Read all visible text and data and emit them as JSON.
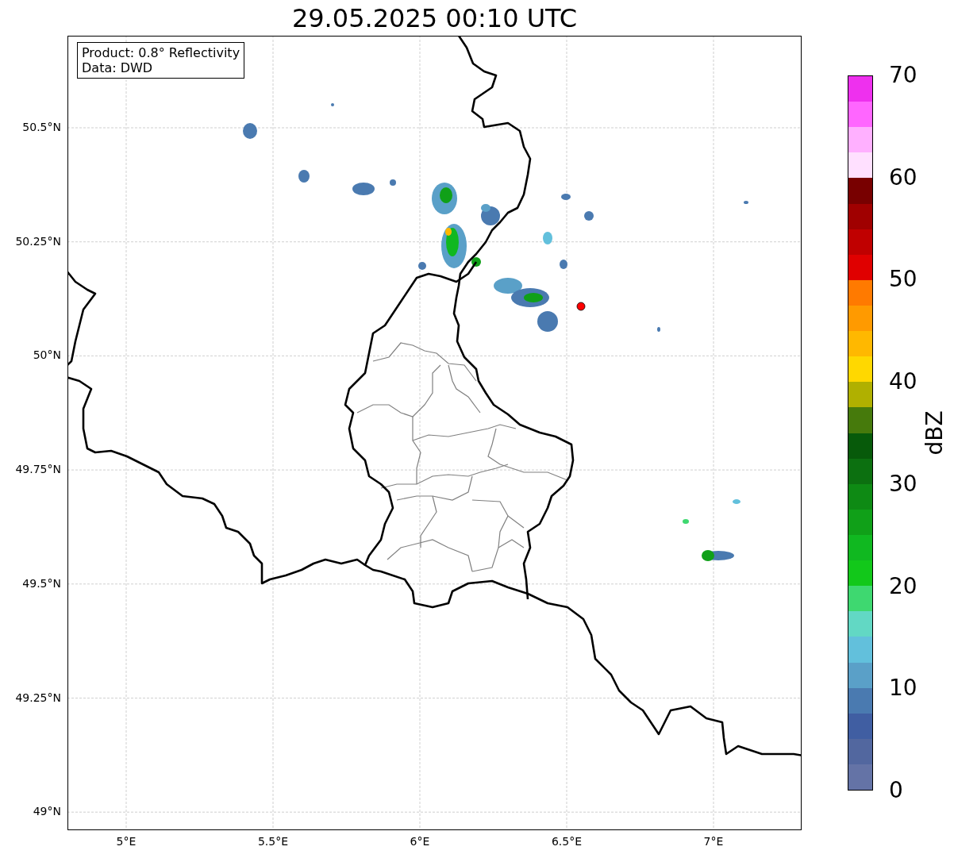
{
  "title": "29.05.2025 00:10 UTC",
  "info_box": [
    "Product: 0.8° Reflectivity",
    "Data: DWD"
  ],
  "map": {
    "x_ticks": [
      "5°E",
      "5.5°E",
      "6°E",
      "6.5°E",
      "7°E"
    ],
    "y_ticks": [
      "50.5°N",
      "50.25°N",
      "50°N",
      "49.75°N",
      "49.5°N",
      "49.25°N",
      "49°N"
    ]
  },
  "colorbar": {
    "label": "dBZ",
    "ticks": [
      "70",
      "60",
      "50",
      "40",
      "30",
      "20",
      "10",
      "0"
    ],
    "segments": [
      {
        "color": "#ee30ee"
      },
      {
        "color": "#ff66ff"
      },
      {
        "color": "#ffb0ff"
      },
      {
        "color": "#ffe0ff"
      },
      {
        "color": "#780000"
      },
      {
        "color": "#a00000"
      },
      {
        "color": "#c00000"
      },
      {
        "color": "#e00000"
      },
      {
        "color": "#ff7a00"
      },
      {
        "color": "#ff9a00"
      },
      {
        "color": "#ffb800"
      },
      {
        "color": "#ffd800"
      },
      {
        "color": "#b0b000"
      },
      {
        "color": "#467a0c"
      },
      {
        "color": "#075a0a"
      },
      {
        "color": "#0c7010"
      },
      {
        "color": "#0e8a14"
      },
      {
        "color": "#10a018"
      },
      {
        "color": "#10b820"
      },
      {
        "color": "#12c81a"
      },
      {
        "color": "#3ed870"
      },
      {
        "color": "#62d8c4"
      },
      {
        "color": "#62c0dc"
      },
      {
        "color": "#5aa0c8"
      },
      {
        "color": "#4a7ab0"
      },
      {
        "color": "#405ea2"
      },
      {
        "color": "#52679f"
      },
      {
        "color": "#6473a6"
      }
    ]
  }
}
